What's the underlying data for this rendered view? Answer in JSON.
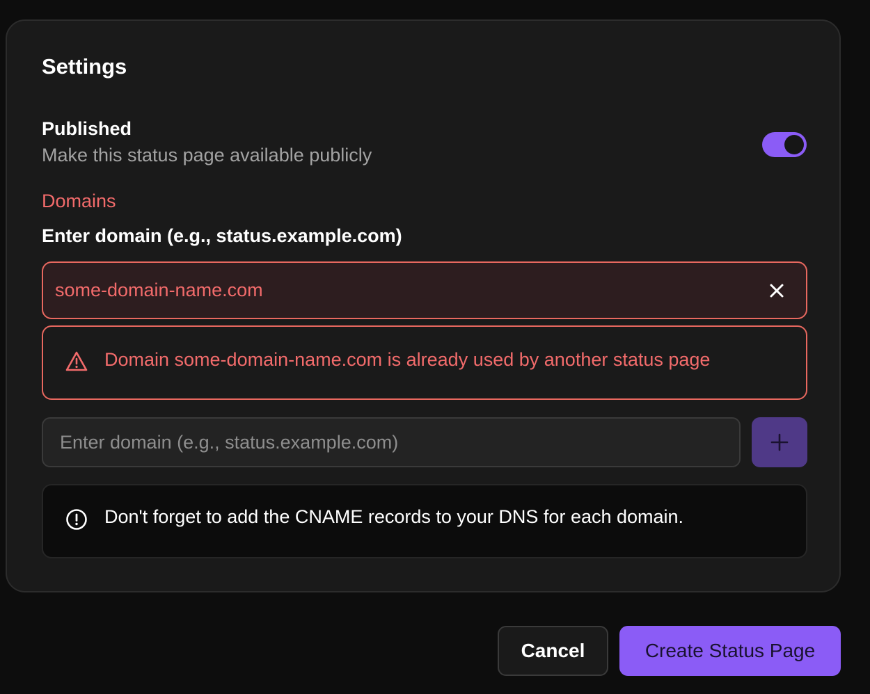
{
  "settings": {
    "title": "Settings",
    "published": {
      "label": "Published",
      "description": "Make this status page available publicly",
      "enabled": true
    },
    "domains": {
      "section_label": "Domains",
      "field_label": "Enter domain (e.g., status.example.com)",
      "entries": [
        {
          "value": "some-domain-name.com",
          "error": "Domain some-domain-name.com is already used by another status page"
        }
      ],
      "new_domain_placeholder": "Enter domain (e.g., status.example.com)",
      "add_icon": "plus-icon",
      "clear_icon": "close-icon",
      "error_icon": "warning-triangle-icon"
    },
    "dns_note": {
      "icon": "info-circle-icon",
      "text": "Don't forget to add the CNAME records to your DNS for each domain."
    }
  },
  "actions": {
    "cancel_label": "Cancel",
    "create_label": "Create Status Page"
  },
  "colors": {
    "accent": "#8b5cf6",
    "error": "#f26b6b",
    "background": "#0d0d0d",
    "card": "#1a1a1a"
  }
}
